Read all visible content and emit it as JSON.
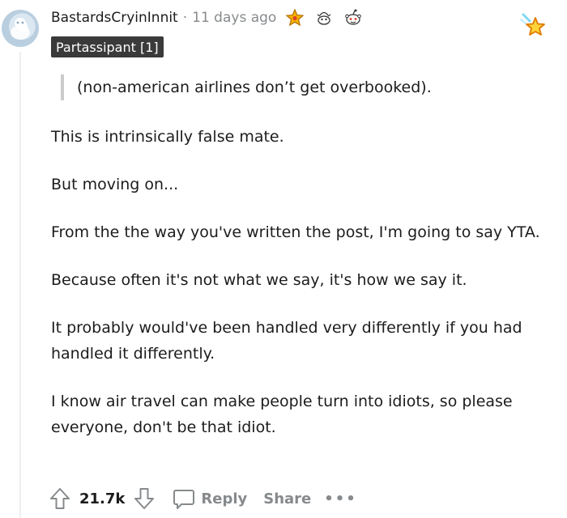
{
  "comment": {
    "author": "BastardsCryinInnit",
    "separator": "·",
    "time_ago": "11 days ago",
    "flair": "Partassipant [1]",
    "awards": [
      "star-award-icon",
      "gift-award-icon",
      "snoo-award-icon"
    ],
    "quote": "(non-american airlines don’t get overbooked).",
    "paragraphs": [
      "This is intrinsically false mate.",
      "But moving on...",
      "From the the way you've written the post, I'm going to say YTA.",
      "Because often it's not what we say, it's how we say it.",
      "It probably would've been handled very differently if you had handled it differently.",
      "I know air travel can make people turn into idiots, so please everyone, don't be that idiot."
    ]
  },
  "actions": {
    "vote_count": "21.7k",
    "reply_label": "Reply",
    "share_label": "Share",
    "more_label": "•••"
  },
  "colors": {
    "text": "#1c1c1c",
    "muted": "#878a8c",
    "flair_bg": "#3a3a3a",
    "quote_bar": "#c9cbcd",
    "award_gold": "#f5b400"
  }
}
